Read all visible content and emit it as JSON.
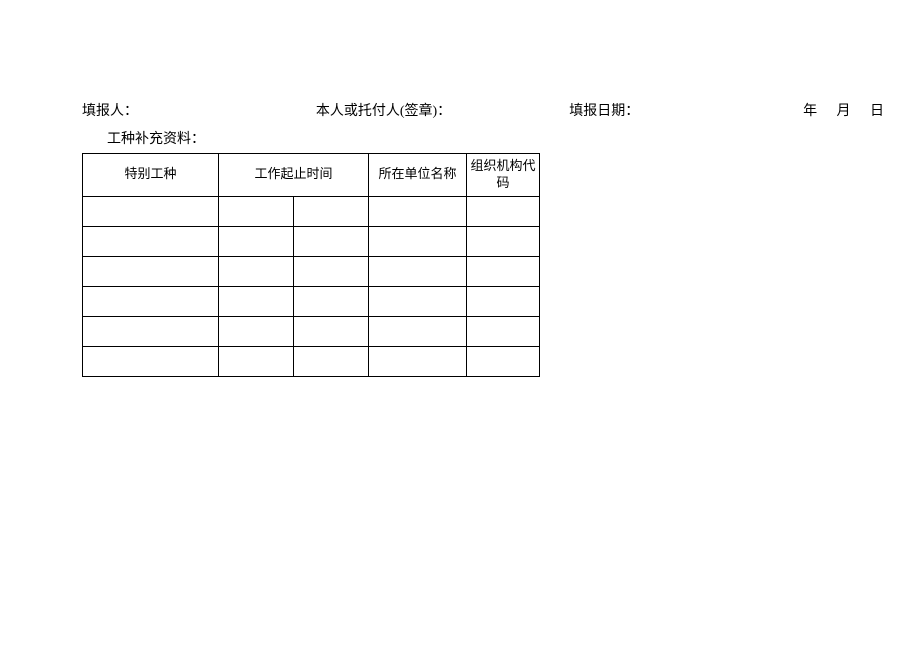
{
  "header": {
    "reporter_label": "填报人：",
    "signatory_label": "本人或托付人(签章)：",
    "report_date_label": "填报日期：",
    "date_parts": "年 月 日"
  },
  "subtitle": "工种补充资料：",
  "table": {
    "headers": {
      "special_job": "特别工种",
      "work_period": "工作起止时间",
      "org_name": "所在单位名称",
      "org_code": "组织机构代码"
    },
    "rows": [
      {
        "c1": "",
        "c2": "",
        "c3": "",
        "c4": "",
        "c5": ""
      },
      {
        "c1": "",
        "c2": "",
        "c3": "",
        "c4": "",
        "c5": ""
      },
      {
        "c1": "",
        "c2": "",
        "c3": "",
        "c4": "",
        "c5": ""
      },
      {
        "c1": "",
        "c2": "",
        "c3": "",
        "c4": "",
        "c5": ""
      },
      {
        "c1": "",
        "c2": "",
        "c3": "",
        "c4": "",
        "c5": ""
      },
      {
        "c1": "",
        "c2": "",
        "c3": "",
        "c4": "",
        "c5": ""
      }
    ]
  }
}
